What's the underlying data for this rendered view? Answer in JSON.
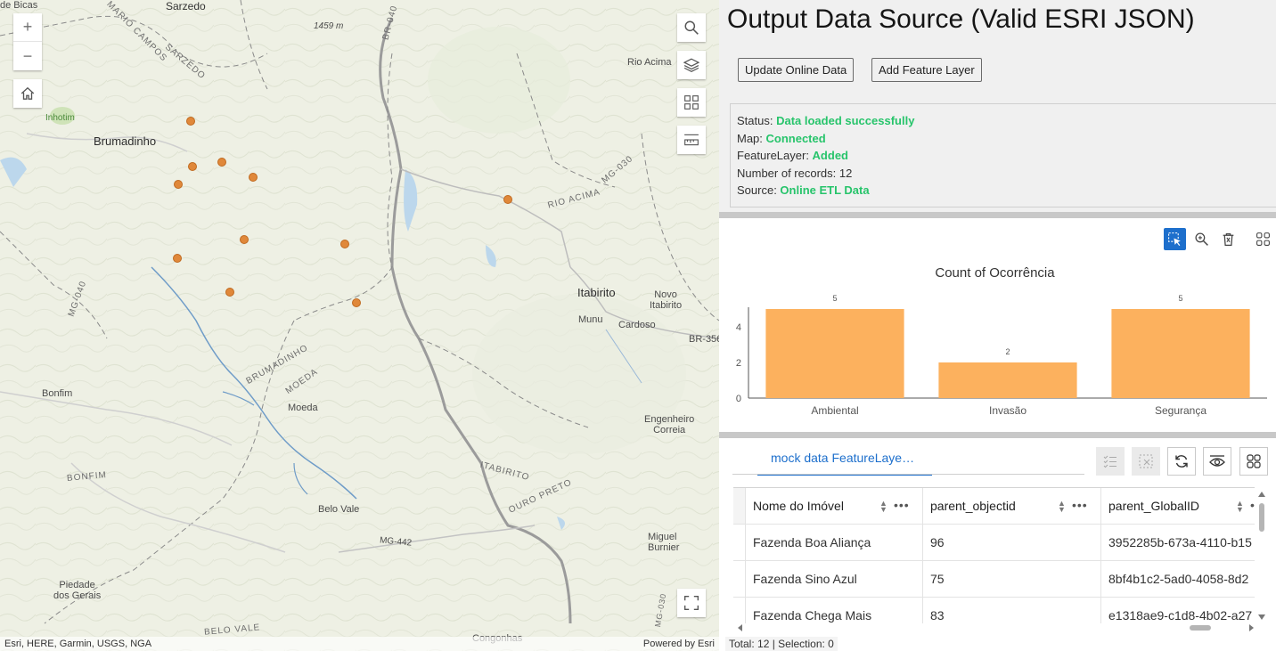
{
  "map": {
    "zoom_in": "+",
    "zoom_out": "−",
    "attribution_left": "Esri, HERE, Garmin, USGS, NGA",
    "attribution_right": "Powered by Esri",
    "labels": {
      "bicas": "de Bicas",
      "sarzedo_top": "Sarzedo",
      "mario_campos": "MARIO CAMPOS",
      "sarzedo_road": "SARZEDO",
      "elev": "1459 m",
      "br040": "BR-040",
      "rio_acima": "Rio Acima",
      "inhotim": "Inhotim",
      "brumadinho": "Brumadinho",
      "mg030": "MG-030",
      "rio_acima_road": "RIO ACIMA",
      "mg040": "MG-040",
      "itabirito": "Itabirito",
      "novo_itabirito": "Novo\nItabirito",
      "munu": "Munu",
      "cardoso": "Cardoso",
      "br356": "BR-356",
      "brumadinho_road": "BRUMADINHO",
      "moeda_road": "MOEDA",
      "bonfim": "Bonfim",
      "moeda": "Moeda",
      "engenheiro_correia": "Engenheiro\nCorreia",
      "bonfim_road": "BONFIM",
      "itabirito_road": "ITABIRITO",
      "ouro_preto_road": "OURO PRETO",
      "belo_vale": "Belo Vale",
      "miguel_burnier": "Miguel\nBurnier",
      "mg442": "MG-442",
      "piedade": "Piedade\ndos Gerais",
      "belo_vale_road": "BELO VALE",
      "congonhas": "Congonhas",
      "mg030b": "MG-030"
    }
  },
  "header": {
    "title": "Output Data Source (Valid ESRI JSON)",
    "update_button": "Update Online Data",
    "add_button": "Add Feature Layer"
  },
  "status": {
    "status_label": "Status: ",
    "status_value": "Data loaded successfully",
    "map_label": "Map: ",
    "map_value": "Connected",
    "layer_label": "FeatureLayer: ",
    "layer_value": "Added",
    "records_label": "Number of records: ",
    "records_value": "12",
    "source_label": "Source: ",
    "source_value": "Online ETL Data"
  },
  "colors": {
    "ok": "#27c46b",
    "bar": "#fcb15e",
    "accent": "#1d6fcc",
    "point": "#e0883a"
  },
  "chart_data": {
    "type": "bar",
    "title": "Count of Ocorrência",
    "categories": [
      "Ambiental",
      "Invasão",
      "Segurança"
    ],
    "values": [
      5,
      2,
      5
    ],
    "ylim": [
      0,
      5
    ],
    "yticks": [
      0,
      2,
      4
    ],
    "data_labels": true,
    "xlabel": "",
    "ylabel": ""
  },
  "table": {
    "tab_label": "mock data FeatureLaye…",
    "columns": [
      "Nome do Imóvel",
      "parent_objectid",
      "parent_GlobalID"
    ],
    "rows": [
      [
        "Fazenda Boa Aliança",
        "96",
        "3952285b-673a-4110-b15"
      ],
      [
        "Fazenda Sino Azul",
        "75",
        "8bf4b1c2-5ad0-4058-8d2"
      ],
      [
        "Fazenda Chega Mais",
        "83",
        "e1318ae9-c1d8-4b02-a27"
      ]
    ],
    "footer": "Total: 12 | Selection: 0"
  }
}
